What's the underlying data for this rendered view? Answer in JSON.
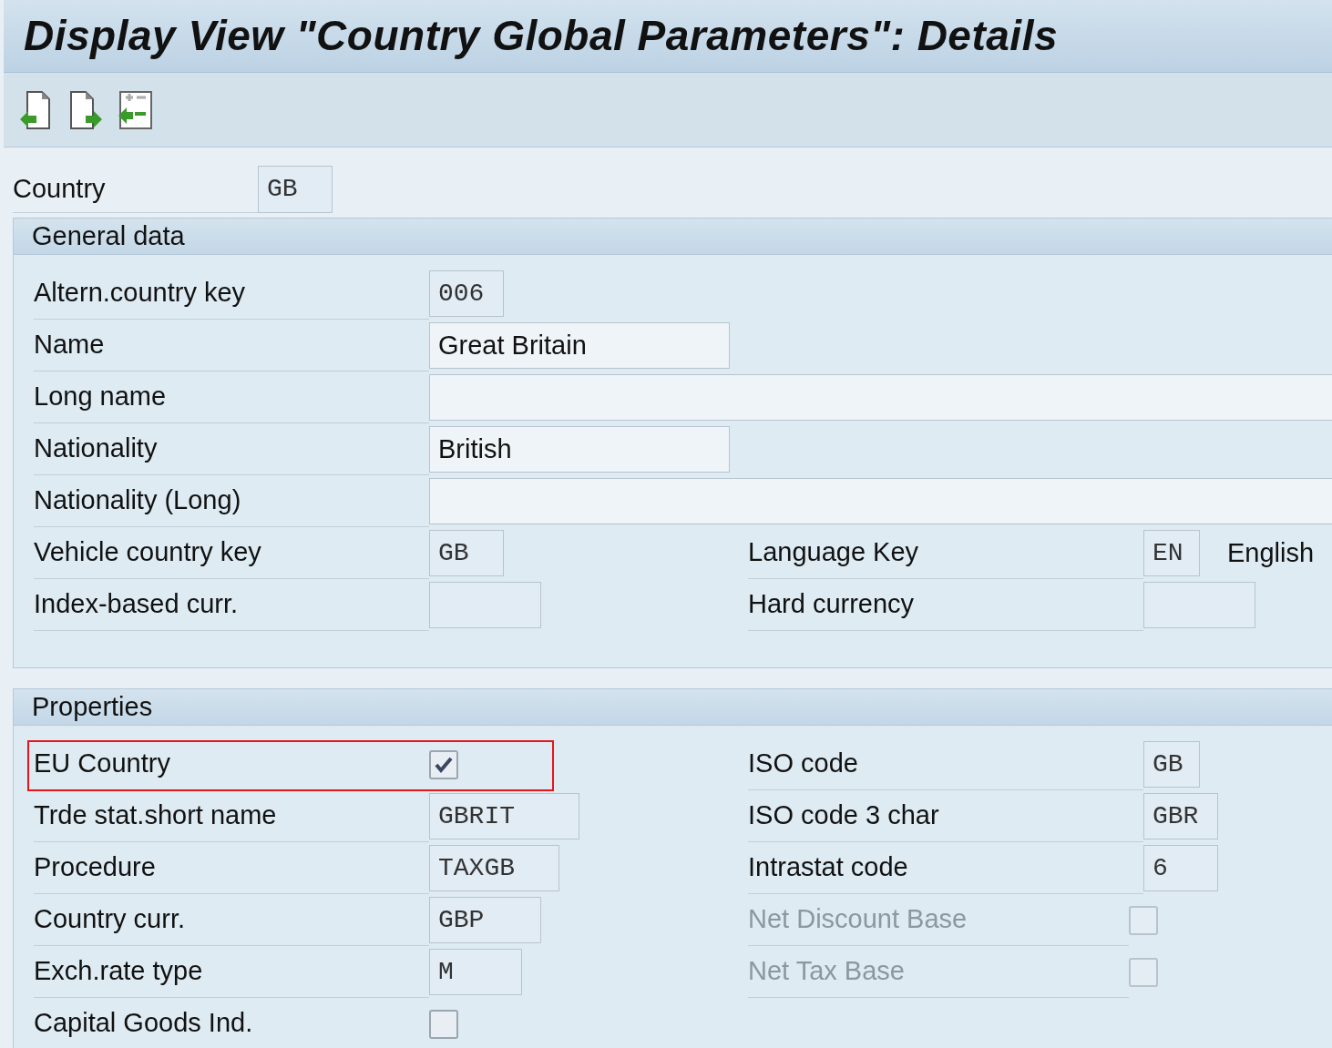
{
  "window": {
    "title": "Display View \"Country Global Parameters\": Details"
  },
  "toolbar": {
    "buttons": [
      {
        "kind": "previous"
      },
      {
        "kind": "next"
      },
      {
        "kind": "select"
      }
    ]
  },
  "country": {
    "label": "Country",
    "value": "GB"
  },
  "general_data": {
    "title": "General data",
    "rows": [
      {
        "left": {
          "label": "Altern.country key",
          "kind": "code",
          "value": "006"
        }
      },
      {
        "left": {
          "label": "Name",
          "kind": "text",
          "value": "Great Britain"
        }
      },
      {
        "left": {
          "label": "Long name",
          "kind": "text"
        }
      },
      {
        "left": {
          "label": "Nationality",
          "kind": "text",
          "value": "British"
        }
      },
      {
        "left": {
          "label": "Nationality (Long)",
          "kind": "text"
        }
      },
      {
        "left": {
          "label": "Vehicle country key",
          "kind": "code",
          "value": "GB"
        },
        "right": {
          "label": "Language Key",
          "kind": "code",
          "value": "EN",
          "description": "English"
        }
      },
      {
        "left": {
          "label": "Index-based curr.",
          "kind": "code"
        },
        "right": {
          "label": "Hard currency",
          "kind": "code"
        }
      }
    ]
  },
  "properties": {
    "title": "Properties",
    "rows": [
      {
        "left": {
          "label": "EU Country",
          "kind": "checkbox",
          "checked": true,
          "disabled": false,
          "highlighted": true
        },
        "right": {
          "label": "ISO code",
          "kind": "code",
          "value": "GB"
        }
      },
      {
        "left": {
          "label": "Trde stat.short name",
          "kind": "code",
          "value": "GBRIT"
        },
        "right": {
          "label": "ISO code 3 char",
          "kind": "code",
          "value": "GBR"
        }
      },
      {
        "left": {
          "label": "Procedure",
          "kind": "code",
          "value": "TAXGB"
        },
        "right": {
          "label": "Intrastat code",
          "kind": "code",
          "value": "6"
        }
      },
      {
        "left": {
          "label": "Country curr.",
          "kind": "code",
          "value": "GBP"
        },
        "right": {
          "label": "Net Discount Base",
          "kind": "checkbox",
          "checked": false,
          "disabled": true
        }
      },
      {
        "left": {
          "label": "Exch.rate type",
          "kind": "code",
          "value": "M"
        },
        "right": {
          "label": "Net Tax Base",
          "kind": "checkbox",
          "checked": false,
          "disabled": true
        }
      },
      {
        "left": {
          "label": "Capital Goods Ind.",
          "kind": "checkbox",
          "checked": false,
          "disabled": false
        }
      }
    ]
  }
}
